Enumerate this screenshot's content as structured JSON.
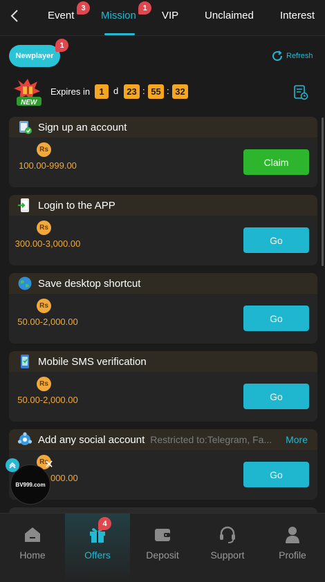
{
  "tabs": [
    {
      "label": "Event",
      "badge": "3"
    },
    {
      "label": "Mission",
      "badge": "1"
    },
    {
      "label": "VIP"
    },
    {
      "label": "Unclaimed"
    },
    {
      "label": "Interest"
    }
  ],
  "newplayer": {
    "label": "Newplayer",
    "badge": "1"
  },
  "refresh_label": "Refresh",
  "expires": {
    "label": "Expires in",
    "days": "1",
    "day_unit": "d",
    "hours": "23",
    "minutes": "55",
    "seconds": "32",
    "new_tag": "NEW"
  },
  "missions": [
    {
      "title": "Sign up an account",
      "currency": "Rs",
      "reward": "100.00-999.00",
      "action": "Claim"
    },
    {
      "title": "Login to the APP",
      "currency": "Rs",
      "reward": "300.00-3,000.00",
      "action": "Go"
    },
    {
      "title": "Save desktop shortcut",
      "currency": "Rs",
      "reward": "50.00-2,000.00",
      "action": "Go"
    },
    {
      "title": "Mobile SMS verification",
      "currency": "Rs",
      "reward": "50.00-2,000.00",
      "action": "Go"
    },
    {
      "title": "Add any social account",
      "restricted": "Restricted to:Telegram, Fa...",
      "more": "More",
      "currency": "Rs",
      "reward": "50.00-2,000.00",
      "action": "Go"
    }
  ],
  "float_widget": {
    "logo_text": "BV999.com"
  },
  "bottom_nav": [
    {
      "label": "Home"
    },
    {
      "label": "Offers",
      "badge": "4"
    },
    {
      "label": "Deposit"
    },
    {
      "label": "Support"
    },
    {
      "label": "Profile"
    }
  ],
  "colors": {
    "accent": "#23b9d2",
    "claim": "#2db52d",
    "gold": "#f0a93a",
    "badge": "#e0484f"
  }
}
